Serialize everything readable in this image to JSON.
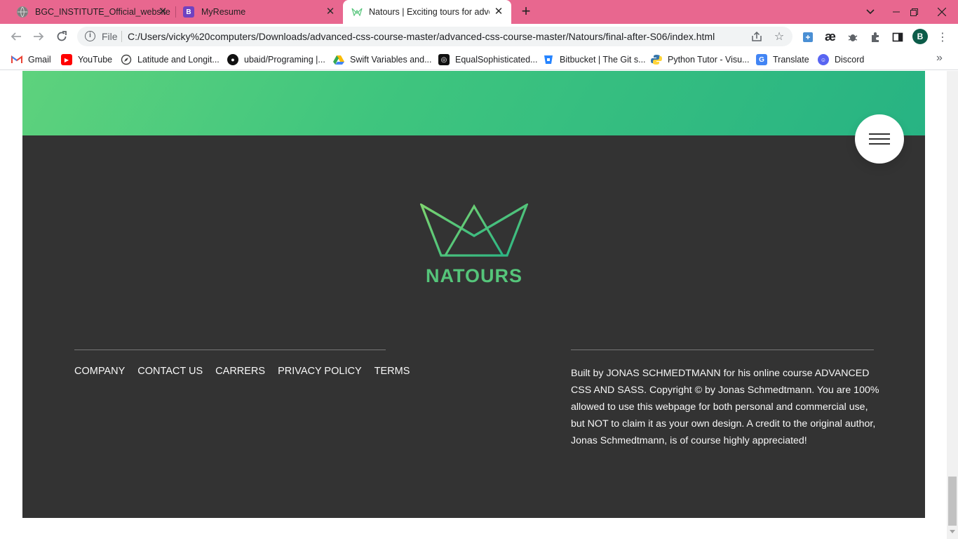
{
  "browser": {
    "tabs": [
      {
        "title": "BGC_INSTITUTE_Official_website",
        "favicon": "globe-icon"
      },
      {
        "title": "MyResume",
        "favicon": "bootstrap-icon",
        "favicon_letter": "B"
      },
      {
        "title": "Natours | Exciting tours for adventurous people",
        "favicon": "natours-icon",
        "active": true
      }
    ],
    "new_tab_label": "+",
    "address": {
      "scheme_label": "File",
      "url": "C:/Users/vicky%20computers/Downloads/advanced-css-course-master/advanced-css-course-master/Natours/final-after-S06/index.html"
    },
    "profile_letter": "B",
    "extension_glyph_ae": "æ",
    "bookmarks": [
      {
        "label": "Gmail",
        "icon": "gmail-icon"
      },
      {
        "label": "YouTube",
        "icon": "youtube-icon"
      },
      {
        "label": "Latitude and Longit...",
        "icon": "compass-icon"
      },
      {
        "label": "ubaid/Programing |...",
        "icon": "github-icon"
      },
      {
        "label": "Swift Variables and...",
        "icon": "drive-icon"
      },
      {
        "label": "EqualSophisticated...",
        "icon": "codepen-icon"
      },
      {
        "label": "Bitbucket | The Git s...",
        "icon": "bitbucket-icon"
      },
      {
        "label": "Python Tutor - Visu...",
        "icon": "python-icon"
      },
      {
        "label": "Translate",
        "icon": "translate-icon"
      },
      {
        "label": "Discord",
        "icon": "discord-icon"
      }
    ]
  },
  "page": {
    "brand": "NATOURS",
    "footer_nav": [
      "COMPANY",
      "CONTACT US",
      "CARRERS",
      "PRIVACY POLICY",
      "TERMS"
    ],
    "copyright": "Built by JONAS SCHMEDTMANN for his online course ADVANCED CSS AND SASS. Copyright © by Jonas Schmedtmann. You are 100% allowed to use this webpage for both personal and commercial use, but NOT to claim it as your own design. A credit to the original author, Jonas Schmedtmann, is of course highly appreciated!"
  },
  "colors": {
    "tab_strip": "#e8678f",
    "green_light": "#5ed27d",
    "green_dark": "#27b383",
    "footer_bg": "#333333",
    "brand_green": "#55c57a"
  }
}
